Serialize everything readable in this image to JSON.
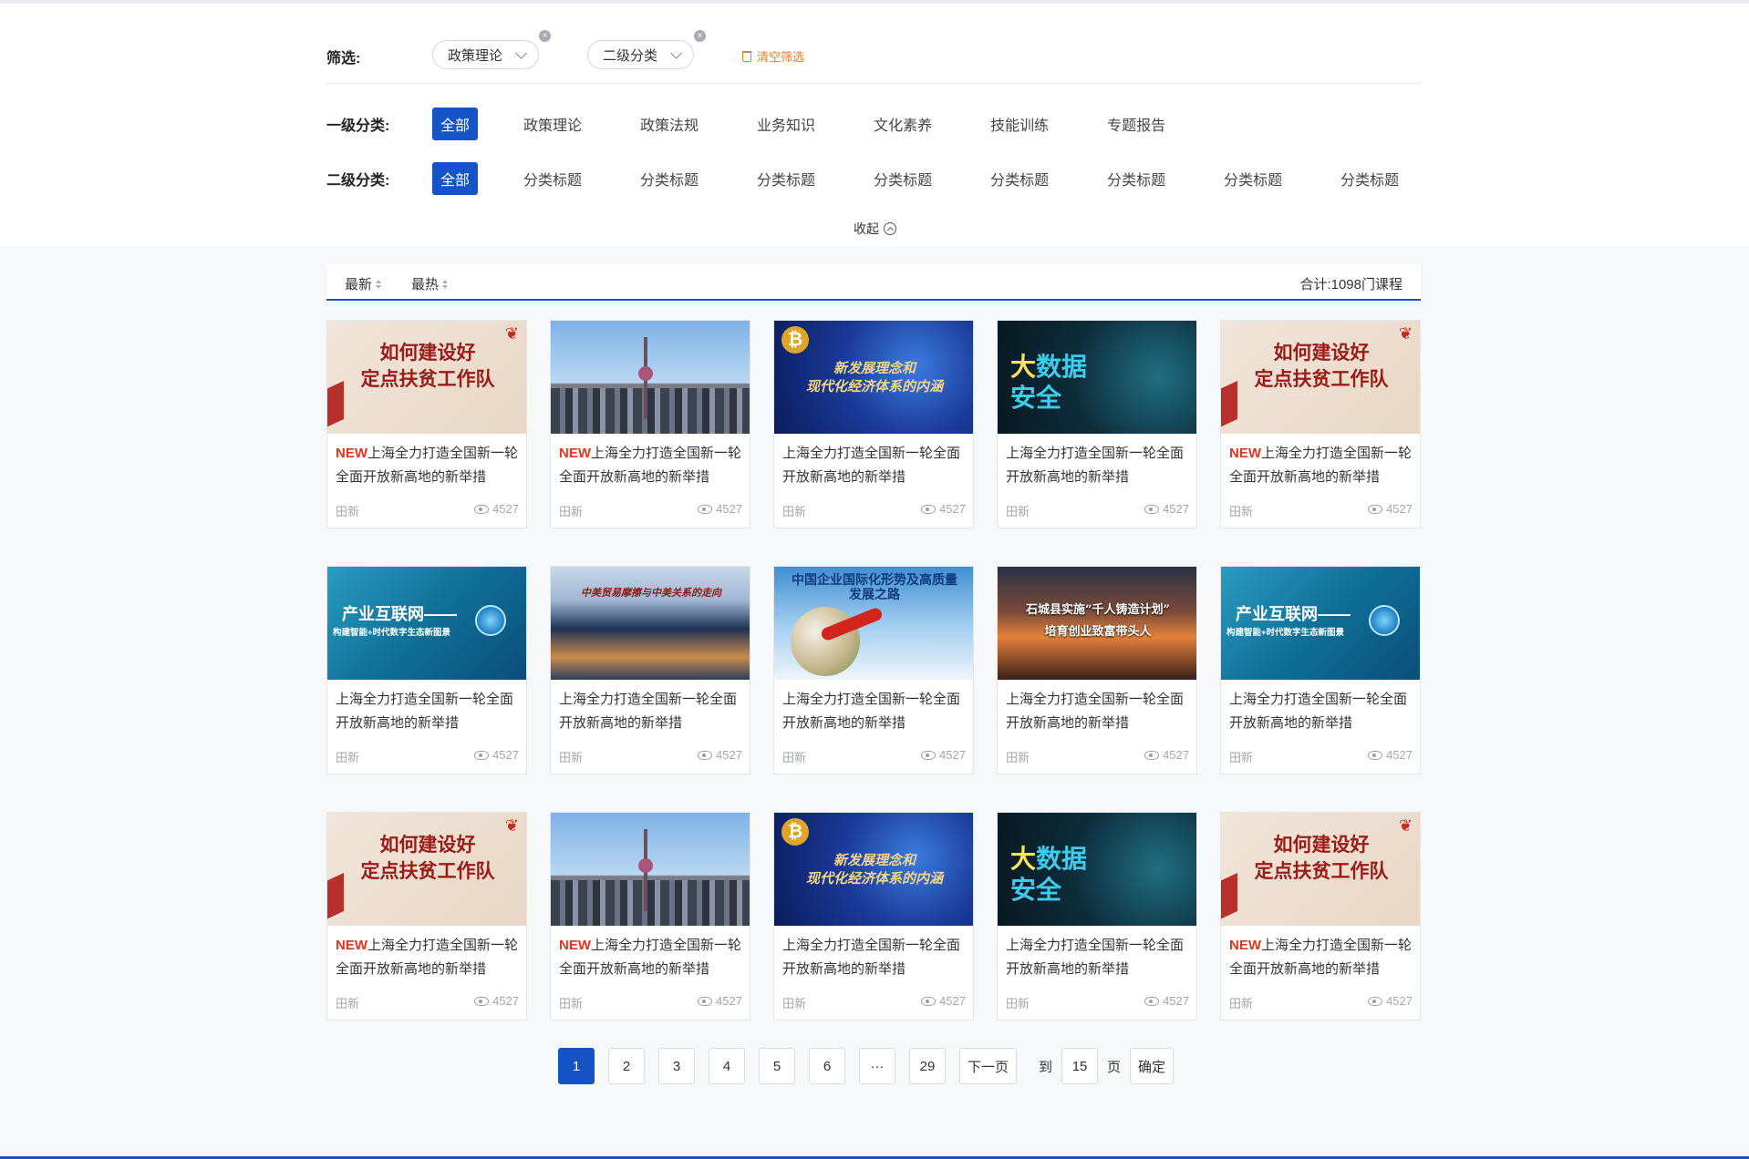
{
  "filter": {
    "label": "筛选:",
    "chips": [
      "政策理论",
      "二级分类"
    ],
    "clear_label": "清空筛选"
  },
  "level1": {
    "label": "一级分类:",
    "items": [
      "全部",
      "政策理论",
      "政策法规",
      "业务知识",
      "文化素养",
      "技能训练",
      "专题报告"
    ]
  },
  "level2": {
    "label": "二级分类:",
    "items": [
      "全部",
      "分类标题",
      "分类标题",
      "分类标题",
      "分类标题",
      "分类标题",
      "分类标题",
      "分类标题",
      "分类标题"
    ]
  },
  "collapse_label": "收起",
  "sort": {
    "newest": "最新",
    "hottest": "最热",
    "total": "合计:1098门课程"
  },
  "cards": [
    {
      "thumb": "如何建设好\n定点扶贫工作队",
      "new_tag": "NEW",
      "title": "上海全力打造全国新一轮全面开放新高地的新举措",
      "author": "田新",
      "views": "4527"
    },
    {
      "thumb": "",
      "new_tag": "NEW",
      "title": "上海全力打造全国新一轮全面开放新高地的新举措",
      "author": "田新",
      "views": "4527"
    },
    {
      "thumb": "新发展理念和\n现代化经济体系的内涵",
      "new_tag": "",
      "title": "上海全力打造全国新一轮全面开放新高地的新举措",
      "author": "田新",
      "views": "4527"
    },
    {
      "thumb": "大数据\n安全",
      "new_tag": "",
      "title": "上海全力打造全国新一轮全面开放新高地的新举措",
      "author": "田新",
      "views": "4527"
    },
    {
      "thumb": "如何建设好\n定点扶贫工作队",
      "new_tag": "NEW",
      "title": "上海全力打造全国新一轮全面开放新高地的新举措",
      "author": "田新",
      "views": "4527"
    },
    {
      "thumb": "产业互联网——",
      "thumb_sub": "构建智能+时代数字生态新图景",
      "new_tag": "",
      "title": "上海全力打造全国新一轮全面开放新高地的新举措",
      "author": "田新",
      "views": "4527"
    },
    {
      "thumb": "中美贸易摩擦与中美关系的走向",
      "new_tag": "",
      "title": "上海全力打造全国新一轮全面开放新高地的新举措",
      "author": "田新",
      "views": "4527"
    },
    {
      "thumb": "中国企业国际化形势及高质量\n发展之路",
      "new_tag": "",
      "title": "上海全力打造全国新一轮全面开放新高地的新举措",
      "author": "田新",
      "views": "4527"
    },
    {
      "thumb": "石城县实施“千人铸造计划”\n培育创业致富带头人",
      "new_tag": "",
      "title": "上海全力打造全国新一轮全面开放新高地的新举措",
      "author": "田新",
      "views": "4527"
    },
    {
      "thumb": "产业互联网——",
      "thumb_sub": "构建智能+时代数字生态新图景",
      "new_tag": "",
      "title": "上海全力打造全国新一轮全面开放新高地的新举措",
      "author": "田新",
      "views": "4527"
    },
    {
      "thumb": "如何建设好\n定点扶贫工作队",
      "new_tag": "NEW",
      "title": "上海全力打造全国新一轮全面开放新高地的新举措",
      "author": "田新",
      "views": "4527"
    },
    {
      "thumb": "",
      "new_tag": "NEW",
      "title": "上海全力打造全国新一轮全面开放新高地的新举措",
      "author": "田新",
      "views": "4527"
    },
    {
      "thumb": "新发展理念和\n现代化经济体系的内涵",
      "new_tag": "",
      "title": "上海全力打造全国新一轮全面开放新高地的新举措",
      "author": "田新",
      "views": "4527"
    },
    {
      "thumb": "大数据\n安全",
      "new_tag": "",
      "title": "上海全力打造全国新一轮全面开放新高地的新举措",
      "author": "田新",
      "views": "4527"
    },
    {
      "thumb": "如何建设好\n定点扶贫工作队",
      "new_tag": "NEW",
      "title": "上海全力打造全国新一轮全面开放新高地的新举措",
      "author": "田新",
      "views": "4527"
    }
  ],
  "pagination": {
    "pages": [
      "1",
      "2",
      "3",
      "4",
      "5",
      "6",
      "···",
      "29"
    ],
    "current": "1",
    "next": "下一页",
    "goto_prefix": "到",
    "goto_value": "15",
    "goto_suffix": "页",
    "confirm": "确定"
  }
}
